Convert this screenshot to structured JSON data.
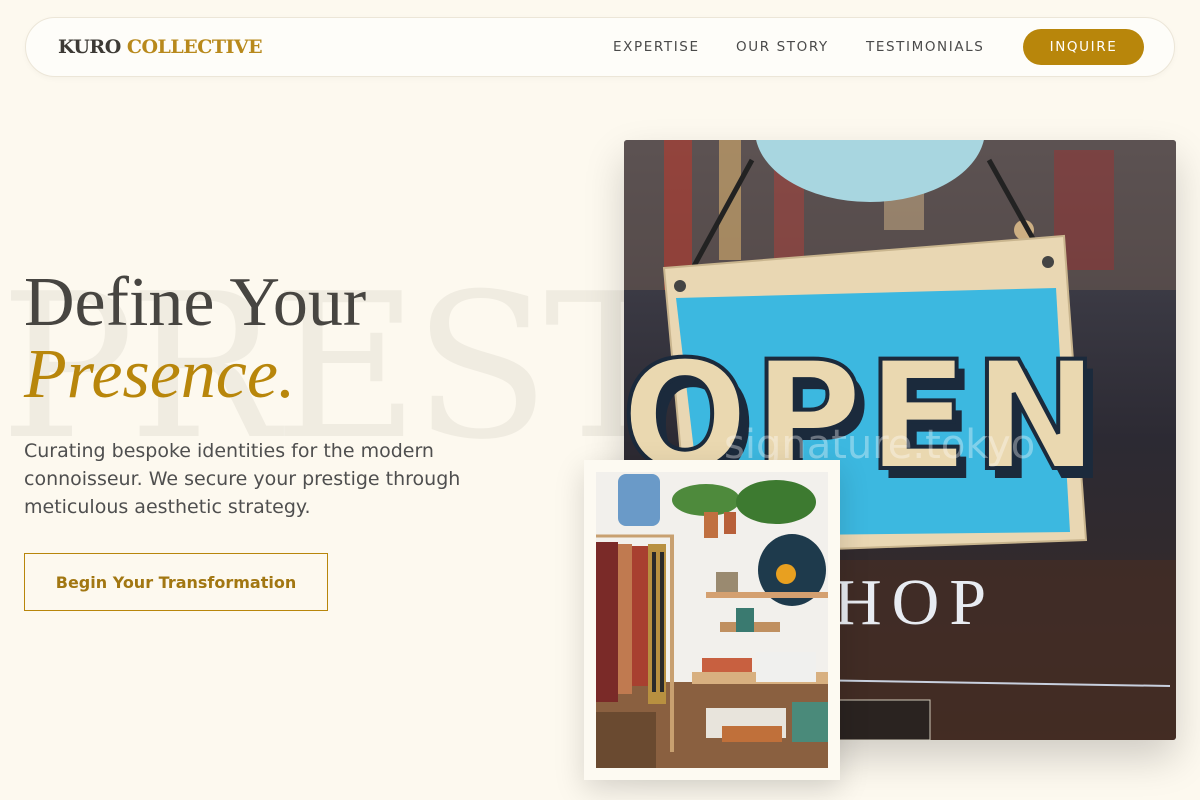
{
  "brand": {
    "part1": "KURO",
    "part2": "COLLECTIVE"
  },
  "nav": {
    "links": [
      "EXPERTISE",
      "OUR STORY",
      "TESTIMONIALS"
    ],
    "cta_label": "INQUIRE"
  },
  "hero": {
    "background_word": "PREST",
    "title_line1": "Define Your",
    "title_line2": "Presence.",
    "subtitle": "Curating bespoke identities for the modern connoisseur. We secure your prestige through meticulous aesthetic strategy.",
    "cta_label": "Begin Your Transformation"
  },
  "images": {
    "main": {
      "sign_text": "OPEN",
      "window_text": "HOP",
      "watermark": "signature.tokyo"
    },
    "secondary": {}
  },
  "colors": {
    "background": "#fdf9ef",
    "accent_gold": "#b8860b",
    "heading": "#474541",
    "sign_blue": "#3cb8e0",
    "sign_board": "#e8d5b0"
  }
}
